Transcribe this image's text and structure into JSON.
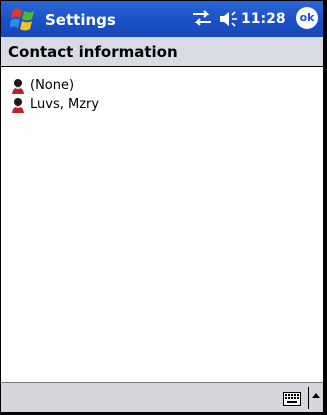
{
  "titlebar": {
    "app_title": "Settings",
    "time": "11:28",
    "ok_label": "ok",
    "icons": [
      "windows-start-icon",
      "connectivity-icon",
      "volume-icon"
    ]
  },
  "header": {
    "title": "Contact information"
  },
  "contacts": [
    {
      "label": "(None)",
      "icon": "contact-icon"
    },
    {
      "label": "Luvs, Mzry",
      "icon": "contact-icon"
    }
  ],
  "bottombar": {
    "icons": [
      "keyboard-icon",
      "input-menu-arrow-icon"
    ]
  },
  "colors": {
    "titlebar": "#1b54c9",
    "header": "#d9dbe4",
    "bottombar": "#d5d6dc"
  }
}
